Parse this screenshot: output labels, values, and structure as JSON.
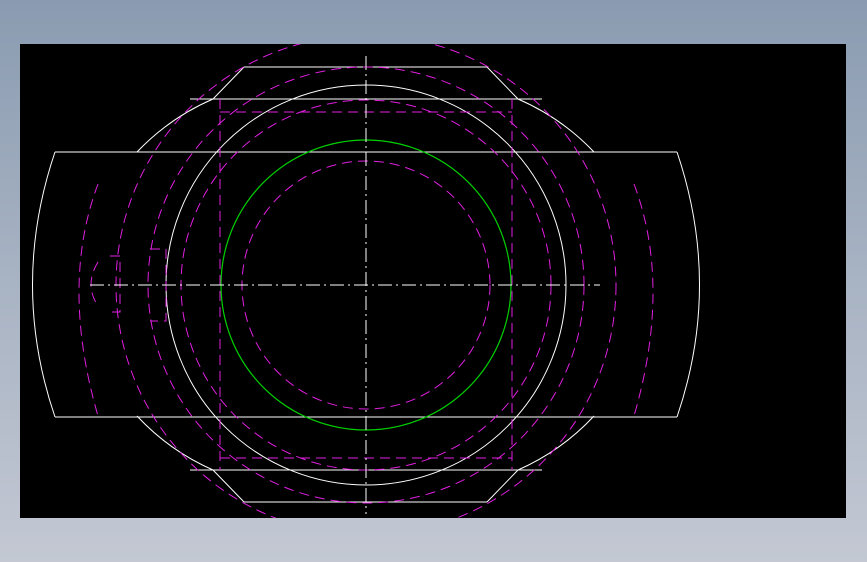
{
  "viewport": {
    "background": "#000000"
  },
  "colors": {
    "visible_edge": "#ffffff",
    "hidden_edge": "#e020e0",
    "bore_circle": "#00d000",
    "centerline": "#ffffff"
  },
  "line_styles": {
    "visible_edge": "solid",
    "hidden_edge": "dashed",
    "centerline": "dash-dot"
  }
}
